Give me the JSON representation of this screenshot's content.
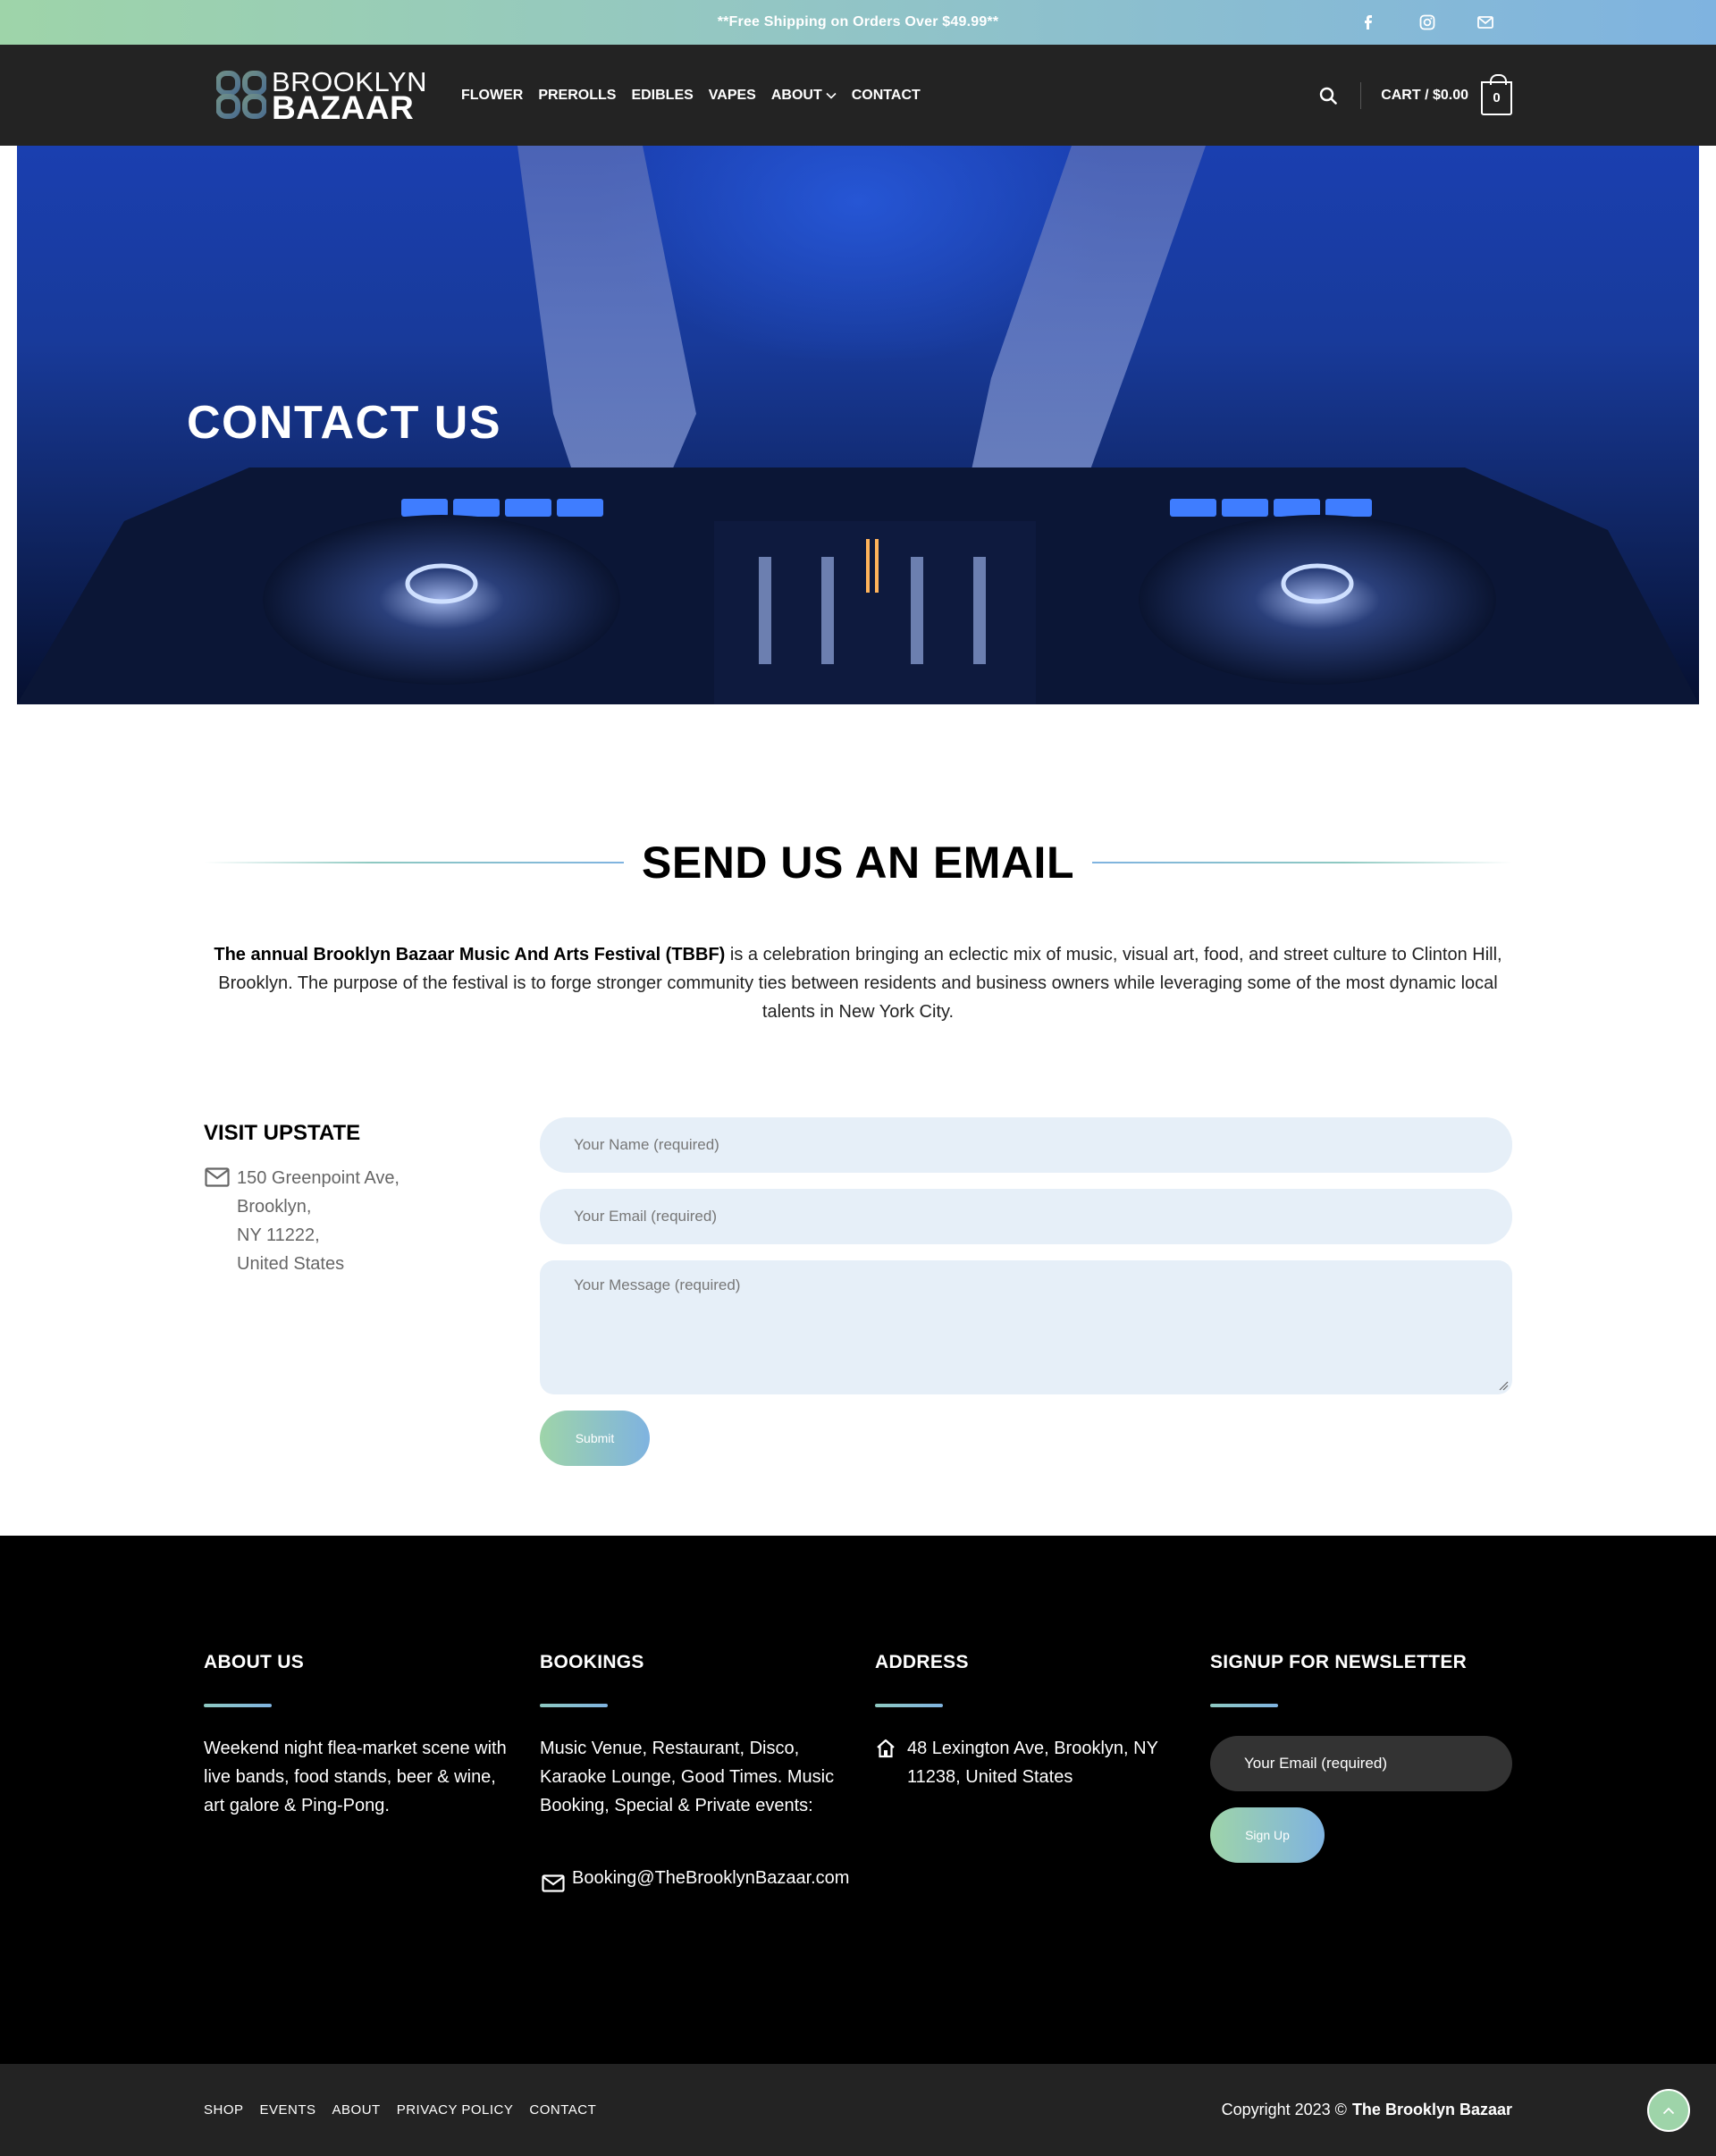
{
  "topbar": {
    "promo": "**Free Shipping on Orders Over $49.99**",
    "social": [
      {
        "icon": "facebook-icon"
      },
      {
        "icon": "instagram-icon"
      },
      {
        "icon": "email-icon"
      }
    ],
    "gradient": [
      "#9ed4a9",
      "#7fb3e0"
    ]
  },
  "header": {
    "logo_line1": "BROOKLYN",
    "logo_line2": "BAZAAR",
    "nav": [
      "FLOWER",
      "PREROLLS",
      "EDIBLES",
      "VAPES",
      "ABOUT",
      "CONTACT"
    ],
    "cart_label": "CART / $0.00",
    "cart_count": "0"
  },
  "hero": {
    "title": "CONTACT US"
  },
  "section": {
    "heading": "SEND US AN EMAIL",
    "intro_bold": "The annual Brooklyn Bazaar Music And Arts Festival (TBBF)",
    "intro_rest": " is a celebration bringing an eclectic mix of music, visual art, food, and street culture to Clinton Hill, Brooklyn. The purpose of the festival is to forge stronger community ties between residents and business owners while leveraging some of the most dynamic local talents in New York City."
  },
  "visit": {
    "title": "VISIT UPSTATE",
    "lines": [
      "150 Greenpoint Ave,",
      "Brooklyn,",
      "NY 11222,",
      "United States"
    ]
  },
  "form": {
    "name_placeholder": "Your Name (required)",
    "email_placeholder": "Your Email (required)",
    "message_placeholder": "Your Message (required)",
    "submit": "Submit"
  },
  "footer": {
    "about": {
      "title": "ABOUT US",
      "text": "Weekend night flea-market scene with live bands, food stands, beer & wine, art galore & Ping-Pong."
    },
    "bookings": {
      "title": "BOOKINGS",
      "text": "Music Venue, Restaurant, Disco, Karaoke Lounge, Good Times. Music Booking, Special & Private events:",
      "email": "Booking@TheBrooklynBazaar.com"
    },
    "address": {
      "title": "ADDRESS",
      "text": "48 Lexington Ave, Brooklyn, NY 11238, United States"
    },
    "newsletter": {
      "title": "SIGNUP FOR NEWSLETTER",
      "placeholder": "Your Email (required)",
      "button": "Sign Up"
    }
  },
  "bottombar": {
    "links": [
      "SHOP",
      "EVENTS",
      "ABOUT",
      "PRIVACY POLICY",
      "CONTACT"
    ],
    "copyright_prefix": "Copyright 2023 ©",
    "copyright_brand": "The Brooklyn Bazaar"
  }
}
